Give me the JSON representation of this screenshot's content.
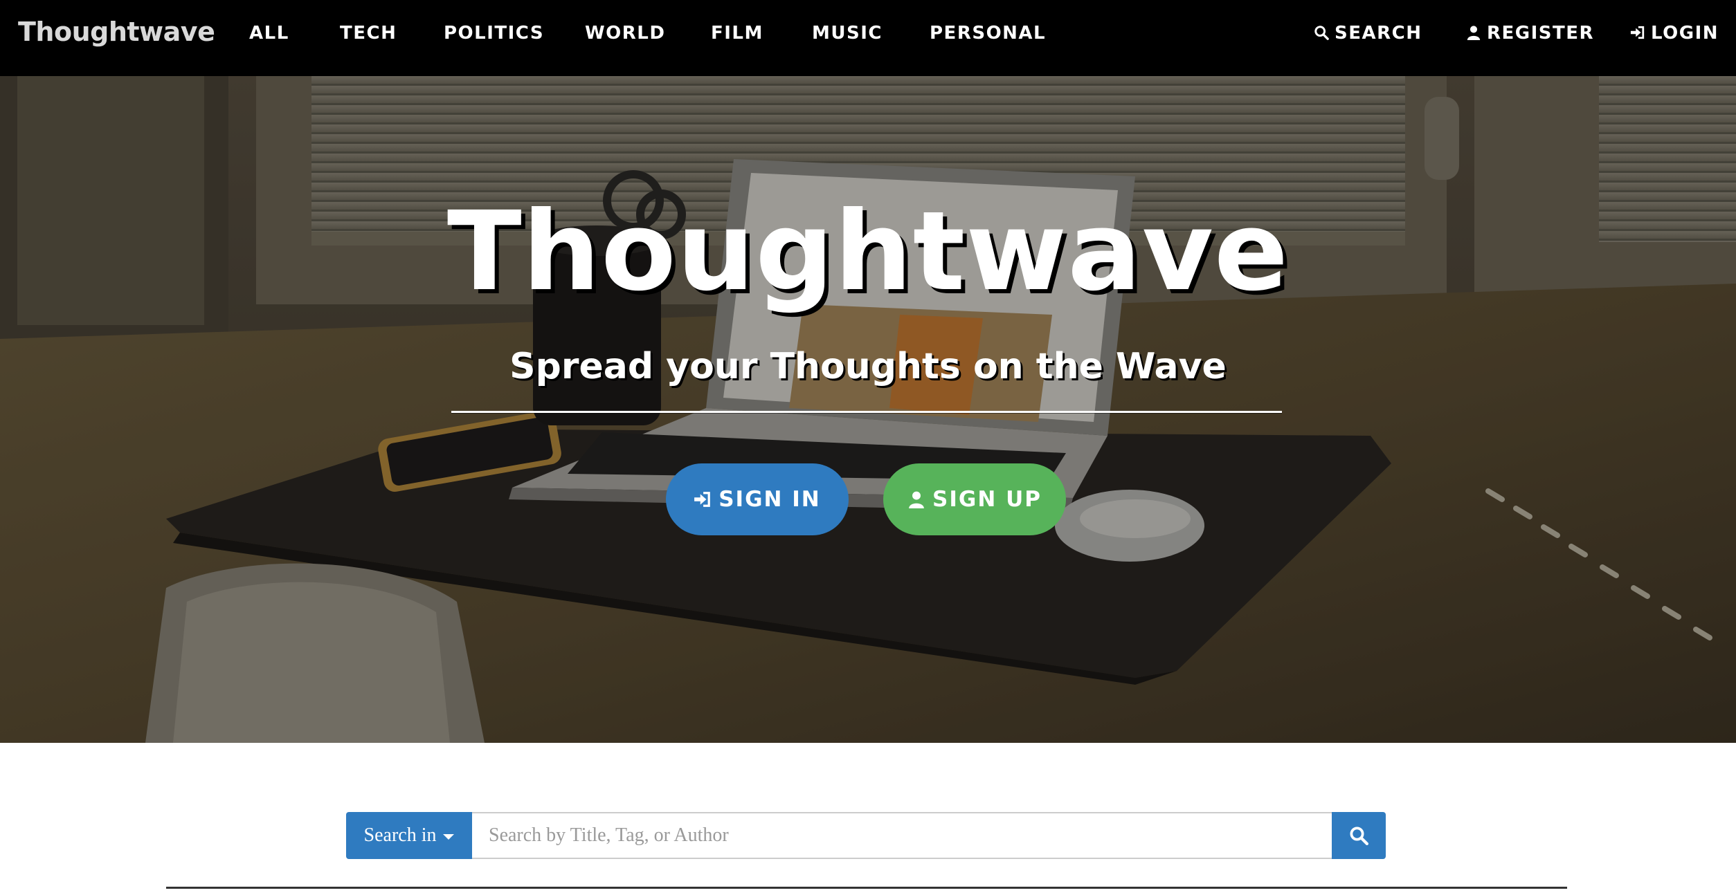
{
  "navbar": {
    "brand": "Thoughtwave",
    "categories": [
      "ALL",
      "TECH",
      "POLITICS",
      "WORLD",
      "FILM",
      "MUSIC",
      "PERSONAL"
    ],
    "search_label": "SEARCH",
    "register_label": "REGISTER",
    "login_label": "LOGIN"
  },
  "hero": {
    "title": "Thoughtwave",
    "subtitle": "Spread your Thoughts on the Wave",
    "signin_label": "SIGN IN",
    "signup_label": "SIGN UP"
  },
  "search": {
    "dropdown_label": "Search in",
    "placeholder": "Search by Title, Tag, or Author",
    "value": ""
  },
  "colors": {
    "navbar_bg": "#000000",
    "primary": "#2f7bc0",
    "success": "#57b35a"
  },
  "icons": {
    "search": "search-icon",
    "register": "user-icon",
    "login": "sign-in-icon"
  }
}
